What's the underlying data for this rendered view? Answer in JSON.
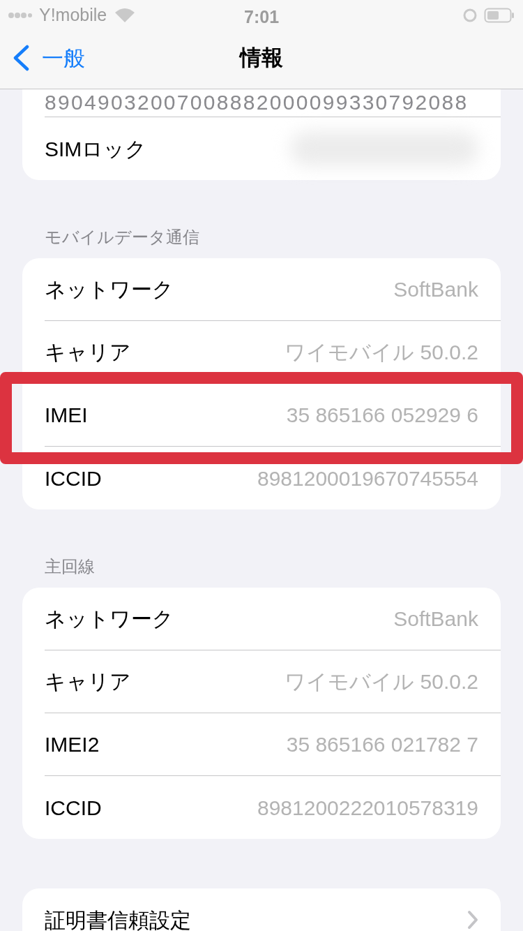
{
  "status_bar": {
    "carrier": "Y!mobile",
    "time": "7:01"
  },
  "nav_bar": {
    "back_label": "一般",
    "title": "情報"
  },
  "sections": [
    {
      "rows": [
        {
          "kind": "number",
          "value": "89049032007008882000099330792088",
          "highlighted": false
        },
        {
          "kind": "blurred",
          "label": "SIMロック",
          "highlighted": false
        }
      ]
    },
    {
      "header": "モバイルデータ通信",
      "rows": [
        {
          "kind": "faded",
          "label": "ネットワーク",
          "value": "SoftBank",
          "highlighted": false
        },
        {
          "kind": "faded",
          "label": "キャリア",
          "value": "ワイモバイル 50.0.2",
          "highlighted": false
        },
        {
          "kind": "faded",
          "label": "IMEI",
          "value": "35 865166 052929 6",
          "highlighted": true
        },
        {
          "kind": "faded",
          "label": "ICCID",
          "value": "8981200019670745554",
          "highlighted": false
        }
      ]
    },
    {
      "header": "主回線",
      "rows": [
        {
          "kind": "faded",
          "label": "ネットワーク",
          "value": "SoftBank",
          "highlighted": false
        },
        {
          "kind": "faded",
          "label": "キャリア",
          "value": "ワイモバイル 50.0.2",
          "highlighted": false
        },
        {
          "kind": "faded",
          "label": "IMEI2",
          "value": "35 865166 021782 7",
          "highlighted": false
        },
        {
          "kind": "faded",
          "label": "ICCID",
          "value": "8981200222010578319",
          "highlighted": false
        }
      ]
    },
    {
      "rows": [
        {
          "kind": "link",
          "label": "証明書信頼設定",
          "highlighted": false
        }
      ]
    }
  ]
}
